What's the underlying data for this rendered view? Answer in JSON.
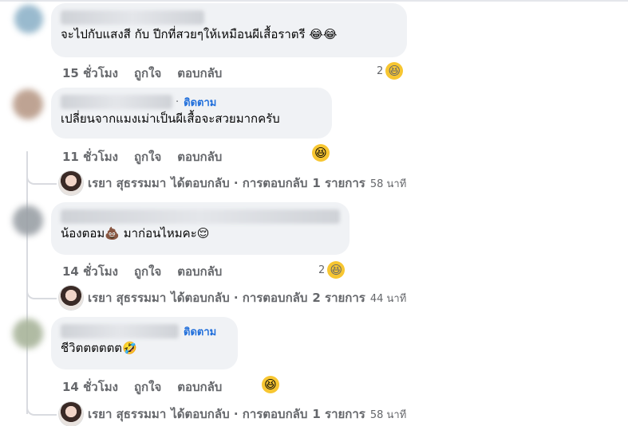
{
  "comments": [
    {
      "text": "จะไปกับแสงสี กับ ปีกที่สวยๆให้เหมือนผีเสื้อราตรี",
      "emoji": "😂😂",
      "time": "15 ชั่วโมง",
      "like": "ถูกใจ",
      "reply": "ตอบกลับ",
      "reaction_count": "2",
      "reaction_emoji": "😆"
    },
    {
      "follow": "ติดตาม",
      "text": "เปลี่ยนจากแมงเม่าเป็นผีเสื้อจะสวยมากครับ",
      "time": "11 ชั่วโมง",
      "like": "ถูกใจ",
      "reply": "ตอบกลับ",
      "reaction_emoji": "😆",
      "replies": {
        "name": "เรยา สุธรรมมา",
        "action": "ได้ตอบกลับ · การตอบกลับ",
        "count": "1 รายการ",
        "ago": "58 นาที"
      }
    },
    {
      "text": "น้องตอม",
      "emoji_mid": "💩",
      "text2": " มาก่อนไหมคะ",
      "emoji": "😌",
      "time": "14 ชั่วโมง",
      "like": "ถูกใจ",
      "reply": "ตอบกลับ",
      "reaction_count": "2",
      "reaction_emoji": "😆",
      "replies": {
        "name": "เรยา สุธรรมมา",
        "action": "ได้ตอบกลับ · การตอบกลับ",
        "count": "2 รายการ",
        "ago": "44 นาที"
      }
    },
    {
      "follow": "ติดตาม",
      "text": "ชีวิตตตตตต",
      "emoji": "🤣",
      "time": "14 ชั่วโมง",
      "like": "ถูกใจ",
      "reply": "ตอบกลับ",
      "reaction_emoji": "😆",
      "replies": {
        "name": "เรยา สุธรรมมา",
        "action": "ได้ตอบกลับ · การตอบกลับ",
        "count": "1 รายการ",
        "ago": "58 นาที"
      }
    }
  ]
}
